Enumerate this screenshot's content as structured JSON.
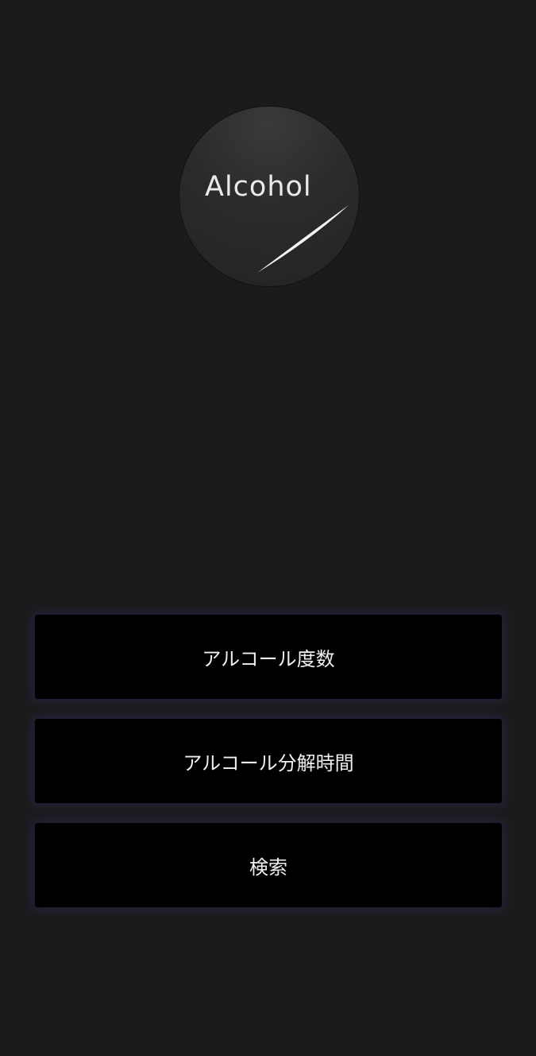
{
  "logo": {
    "text": "Alcohol"
  },
  "menu": {
    "items": [
      {
        "label": "アルコール度数"
      },
      {
        "label": "アルコール分解時間"
      },
      {
        "label": "検索"
      }
    ]
  }
}
